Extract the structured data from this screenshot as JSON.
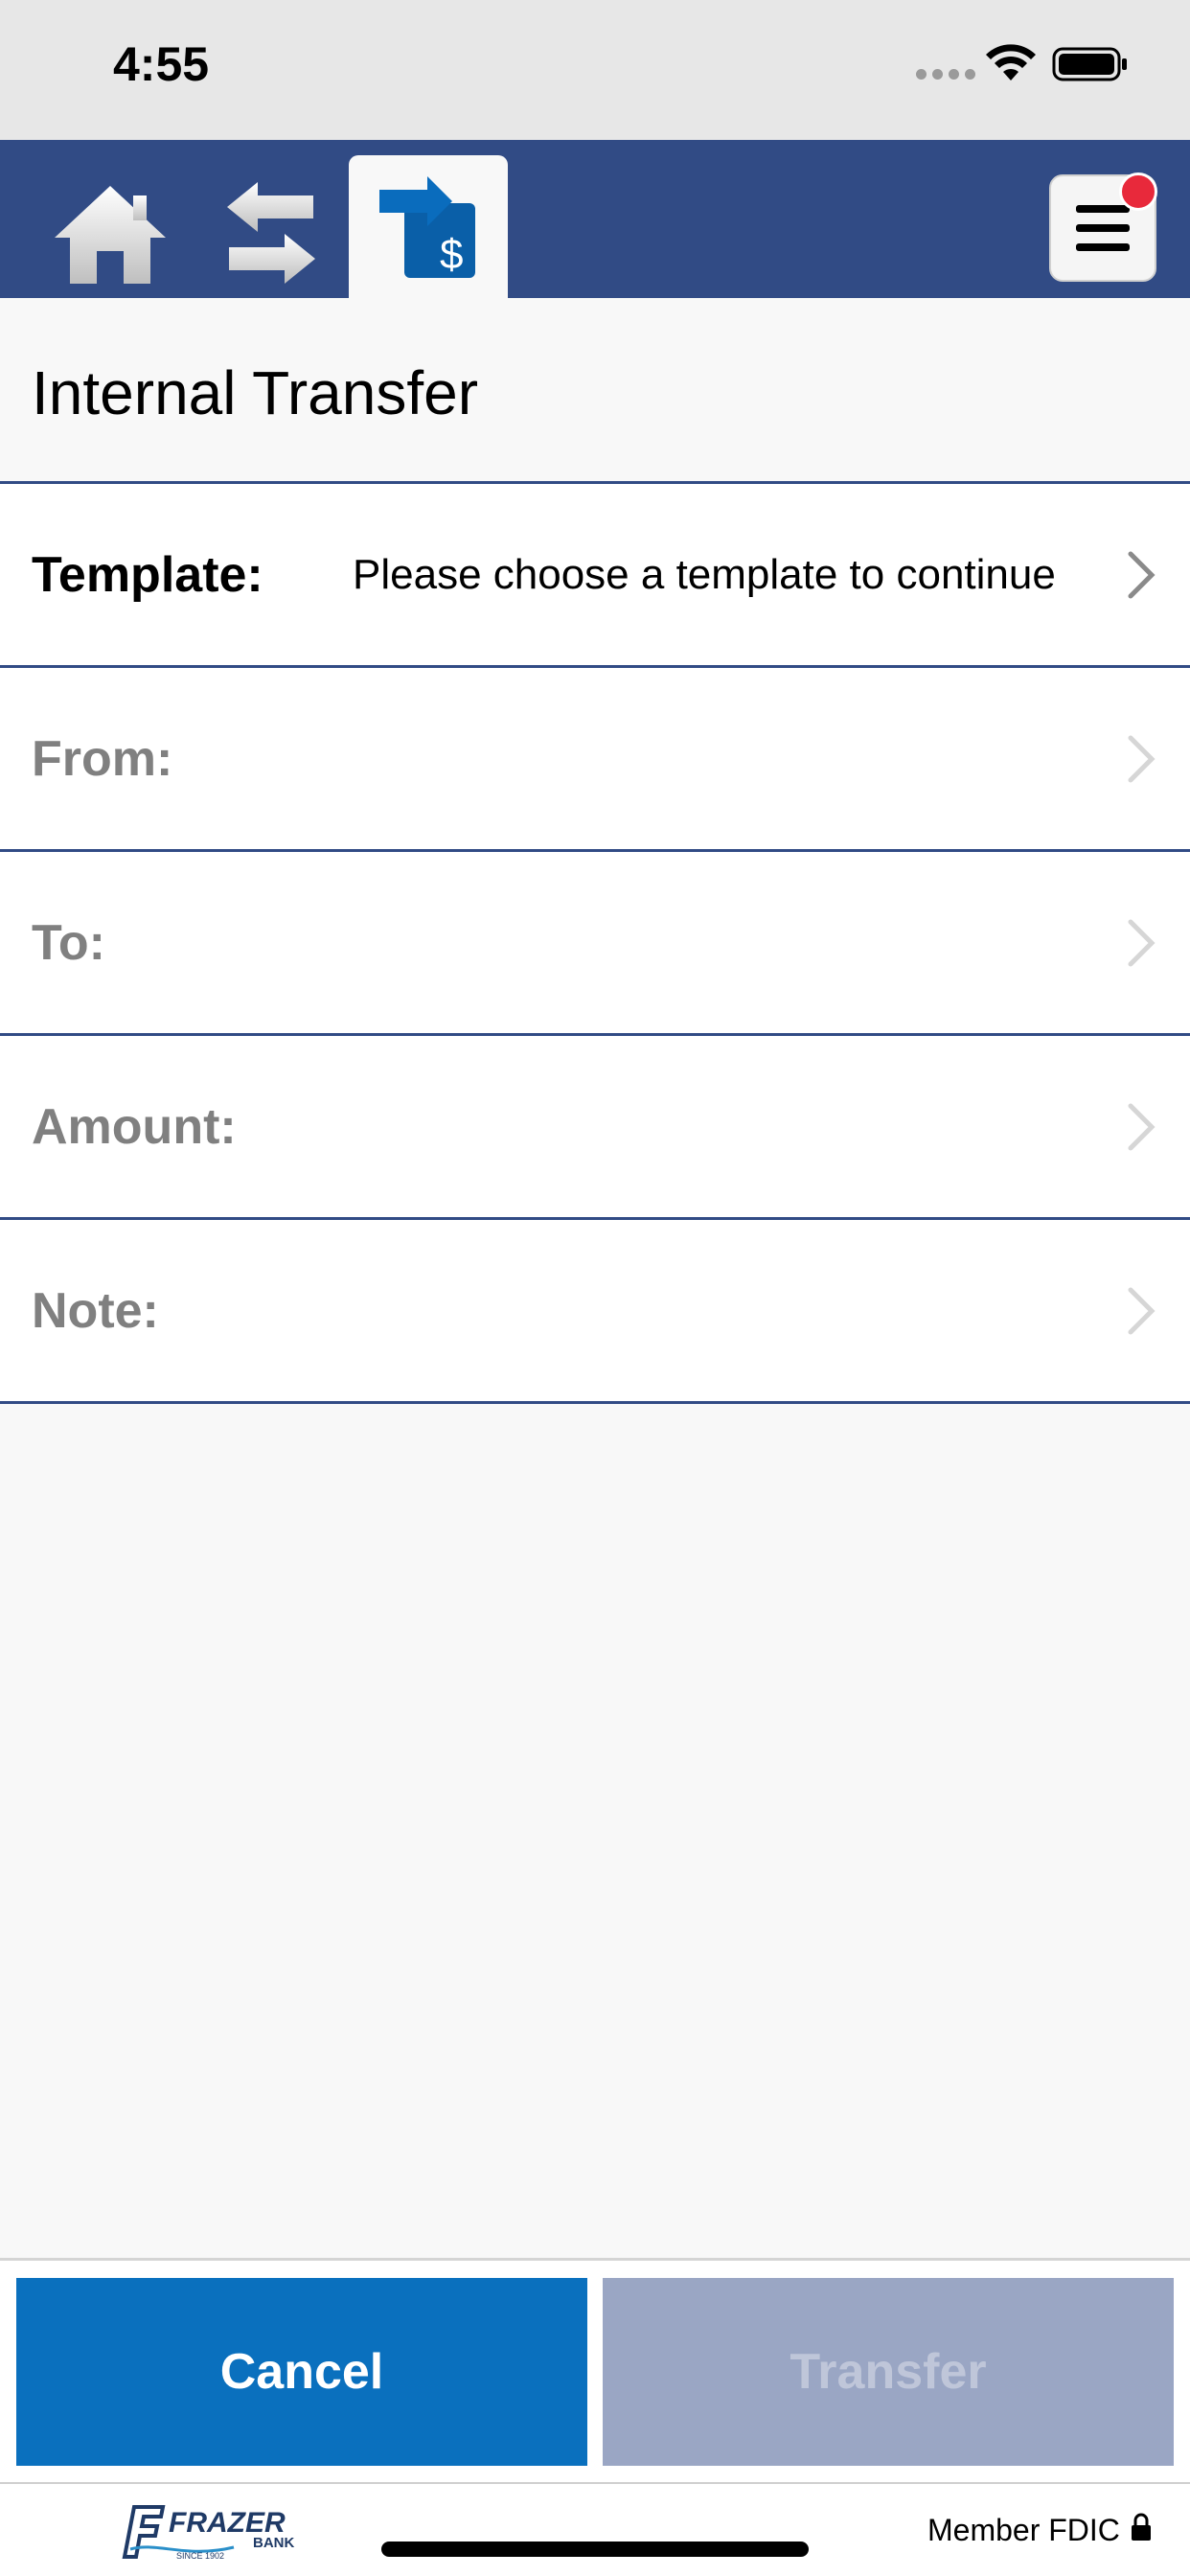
{
  "status_bar": {
    "time": "4:55"
  },
  "nav": {
    "home_icon": "home-icon",
    "transfers_icon": "arrows-exchange-icon",
    "internal_transfer_icon": "transfer-dollar-icon",
    "menu_icon": "hamburger-menu-icon",
    "accent_color": "#314b85",
    "notification_color": "#e8293b"
  },
  "page": {
    "title": "Internal Transfer"
  },
  "form": {
    "template_label": "Template:",
    "template_value": "Please choose a template to continue",
    "from_label": "From:",
    "to_label": "To:",
    "amount_label": "Amount:",
    "note_label": "Note:"
  },
  "actions": {
    "cancel_label": "Cancel",
    "transfer_label": "Transfer",
    "cancel_color": "#0a70be",
    "transfer_disabled_color": "#9aa6c4"
  },
  "footer": {
    "bank_logo_text": "FRAZER BANK",
    "logo_tagline": "SINCE 1902",
    "member_text": "Member FDIC"
  }
}
